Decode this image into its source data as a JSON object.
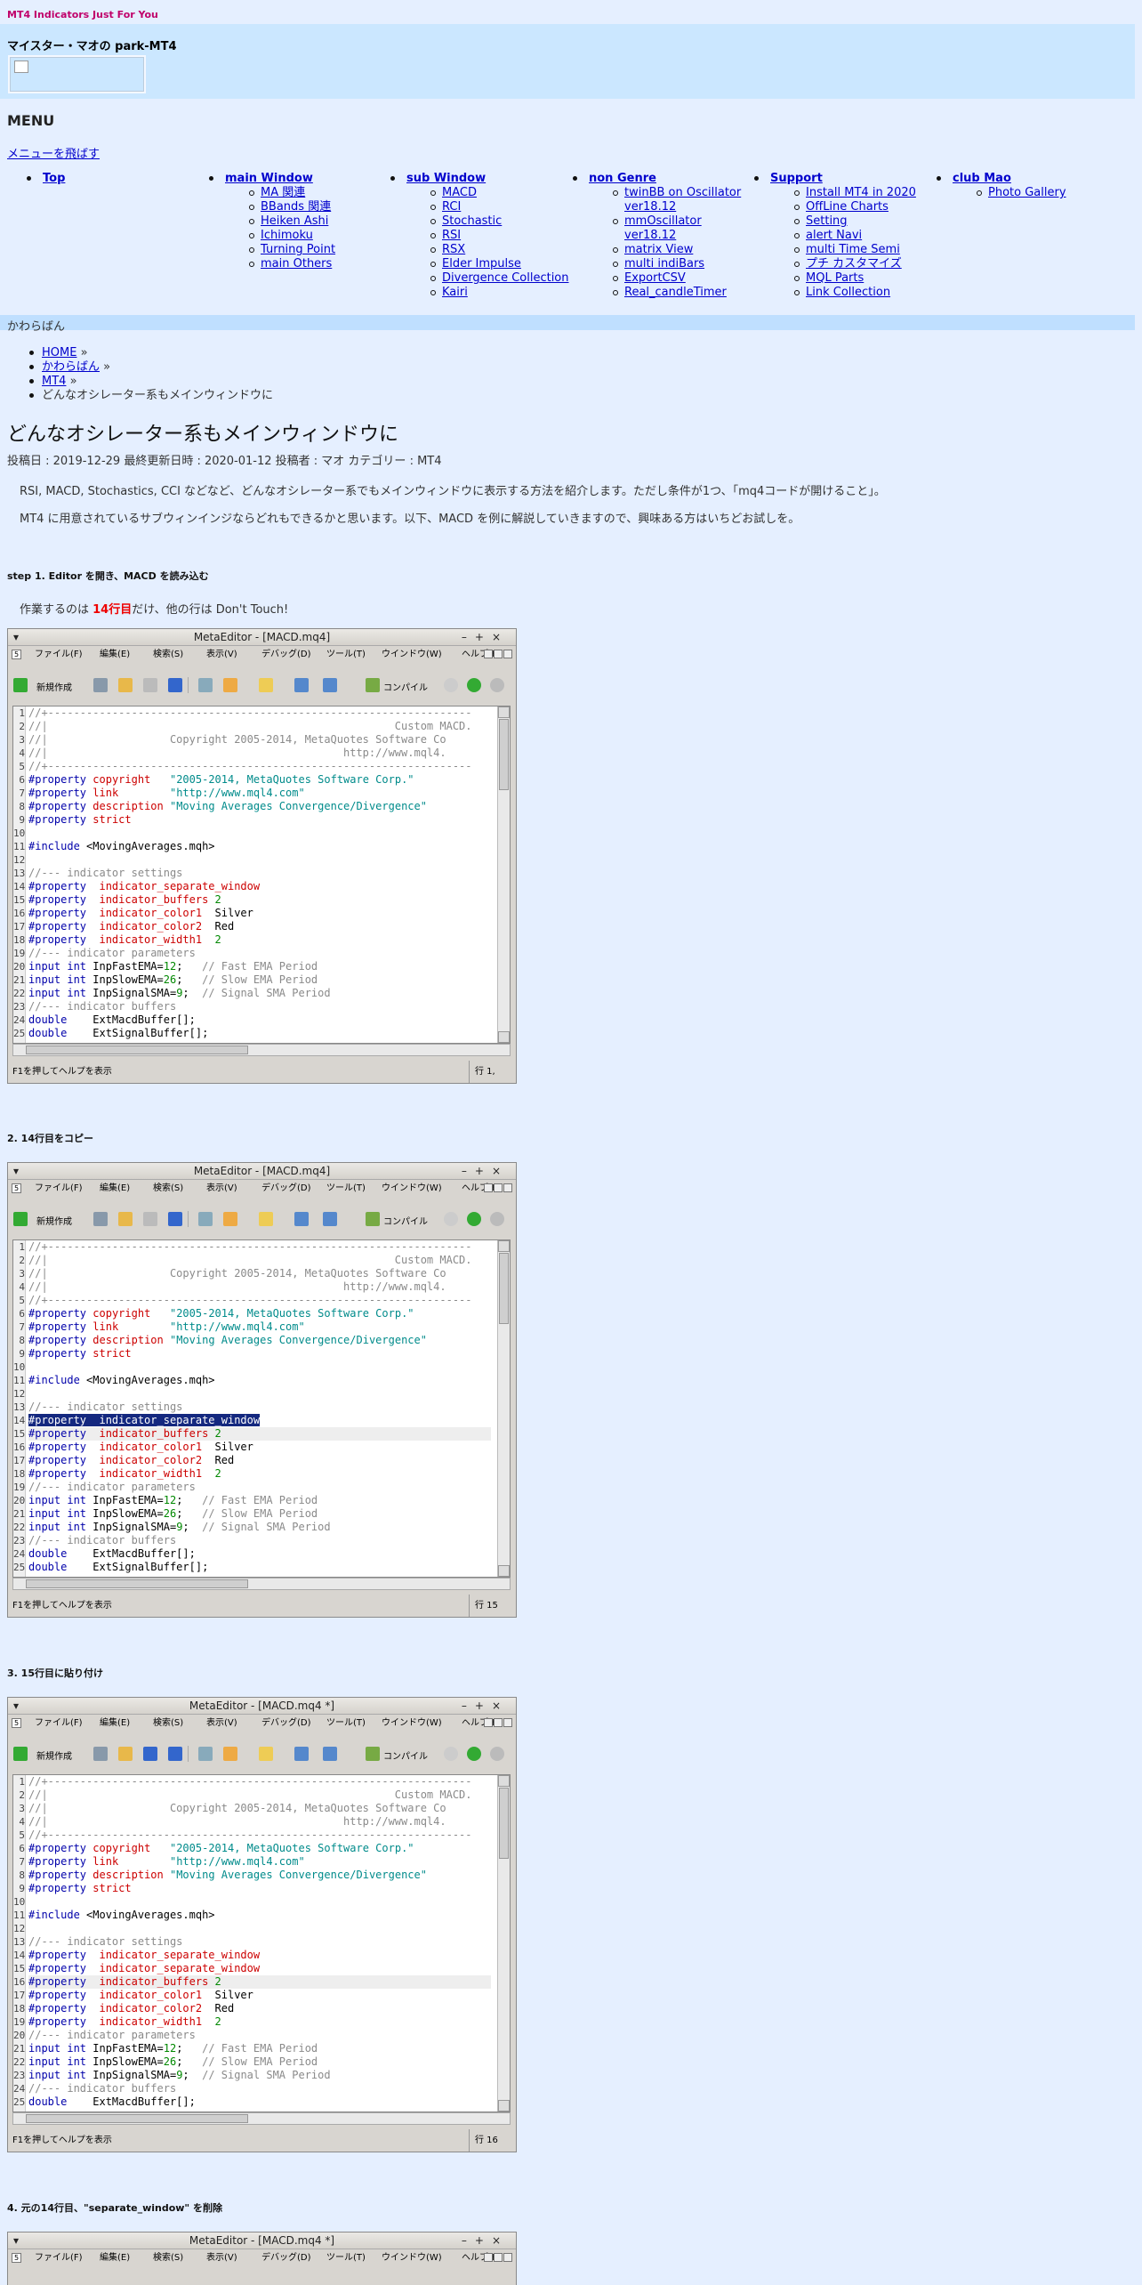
{
  "site": {
    "tagline": "MT4 Indicators Just For You",
    "title": "マイスター・マオの park-MT4"
  },
  "menu": {
    "heading": "MENU",
    "skip": "メニューを飛ばす",
    "columns": [
      {
        "title": "Top",
        "items": []
      },
      {
        "title": "main Window",
        "items": [
          "MA 関連",
          "BBands 関連",
          "Heiken Ashi",
          "Ichimoku",
          "Turning Point",
          "main Others"
        ]
      },
      {
        "title": "sub Window",
        "items": [
          "MACD",
          "RCI",
          "Stochastic",
          "RSI",
          "RSX",
          "Elder Impulse",
          "Divergence Collection",
          "Kairi"
        ]
      },
      {
        "title": "non Genre",
        "items": [
          "twinBB on Oscillator ver18.12",
          "mmOscillator ver18.12",
          "matrix View",
          "multi indiBars",
          "ExportCSV",
          "Real_candleTimer"
        ]
      },
      {
        "title": "Support",
        "items": [
          "Install MT4 in 2020",
          "OffLine Charts",
          "Setting",
          "alert Navi",
          "multi Time Semi",
          "プチ カスタマイズ",
          "MQL Parts",
          "Link Collection"
        ]
      },
      {
        "title": "club Mao",
        "items": [
          "Photo Gallery"
        ]
      }
    ]
  },
  "category_bar": "かわらばん",
  "breadcrumb": [
    "HOME",
    "かわらばん",
    "MT4",
    "どんなオシレーター系もメインウィンドウに"
  ],
  "breadcrumb_sep": "»",
  "article": {
    "title": "どんなオシレーター系もメインウィンドウに",
    "meta": "投稿日 : 2019-12-29 最終更新日時 : 2020-01-12 投稿者 : マオ カテゴリー : MT4",
    "intro1": "RSI, MACD, Stochastics, CCI などなど、どんなオシレーター系でもメインウィンドウに表示する方法を紹介します。ただし条件が1つ、「mq4コードが開けること」。",
    "intro2": "MT4 に用意されているサブウィンインジならどれもできるかと思います。以下、MACD を例に解説していきますので、興味ある方はいちどお試しを。",
    "step1": "step 1. Editor を開き、MACD を読み込む",
    "note_pre": "作業するのは ",
    "note_red": "14行目",
    "note_post": "だけ、他の行は Don't Touch!",
    "step2": "2. 14行目をコピー",
    "step3": "3. 15行目に貼り付け",
    "step4": "4. 元の14行目、\"separate_window\" を削除"
  },
  "editor": {
    "menus": [
      "ファイル(F)",
      "編集(E)",
      "検索(S)",
      "表示(V)",
      "デバッグ(D)",
      "ツール(T)",
      "ウインドウ(W)",
      "ヘルプ(H)"
    ],
    "new_label": "新規作成",
    "compile_label": "コンパイル",
    "status_help": "F1を押してヘルプを表示",
    "windows": [
      {
        "title": "MetaEditor - [MACD.mq4]",
        "status_line": "行 1,"
      },
      {
        "title": "MetaEditor - [MACD.mq4]",
        "status_line": "行 15"
      },
      {
        "title": "MetaEditor - [MACD.mq4 *]",
        "status_line": "行 16"
      },
      {
        "title": "MetaEditor - [MACD.mq4 *]"
      }
    ]
  }
}
